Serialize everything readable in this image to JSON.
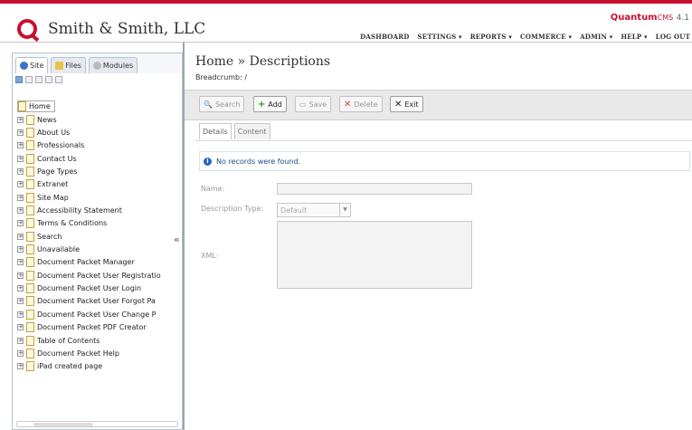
{
  "header": {
    "company": "Smith & Smith, LLC",
    "brand_main": "Quantum",
    "brand_cms": "CMS",
    "brand_version": "4.1",
    "nav": [
      "DASHBOARD",
      "SETTINGS ▾",
      "REPORTS ▾",
      "COMMERCE ▾",
      "ADMIN ▾",
      "HELP ▾",
      "LOG OUT"
    ]
  },
  "sidebar": {
    "tabs": [
      "Site",
      "Files",
      "Modules"
    ],
    "root": "Home",
    "items": [
      "News",
      "About Us",
      "Professionals",
      "Contact Us",
      "Page Types",
      "Extranet",
      "Site Map",
      "Accessibility Statement",
      "Terms & Conditions",
      "Search",
      "Unavailable",
      "Document Packet Manager",
      "Document Packet User Registratio",
      "Document Packet User Login",
      "Document Packet User Forgot Pa",
      "Document Packet User Change P",
      "Document Packet PDF Creator",
      "Table of Contents",
      "Document Packet Help",
      "iPad created page"
    ],
    "collapse_label": "«"
  },
  "main": {
    "title": "Home » Descriptions",
    "breadcrumb": "Breadcrumb: /",
    "toolbar": {
      "search": "Search",
      "add": "Add",
      "save": "Save",
      "delete": "Delete",
      "exit": "Exit"
    },
    "form_tabs": [
      "Details",
      "Content"
    ],
    "notice": "No records were found.",
    "fields": {
      "name_label": "Name:",
      "description_type_label": "Description Type:",
      "description_type_value": "Default",
      "xml_label": "XML:"
    }
  },
  "colors": {
    "accent": "#c8102e",
    "info": "#2266c4"
  }
}
